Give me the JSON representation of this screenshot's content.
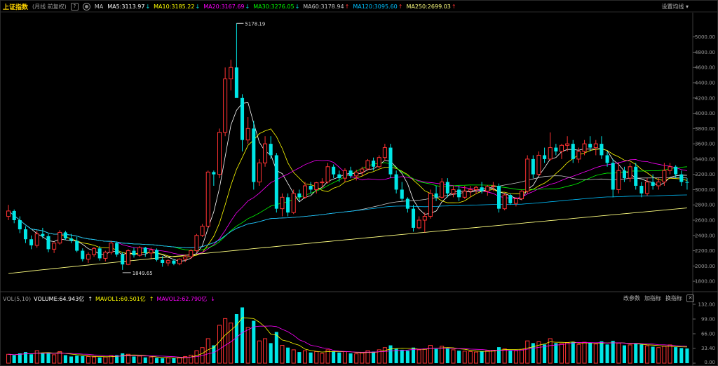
{
  "header": {
    "title": "上证指数",
    "subtitle": "(月线 前复权)",
    "help_icon": "question-icon",
    "settings_icon": "gear-icon",
    "ma_label": "MA",
    "ma": [
      {
        "label": "MA5:3113.97",
        "color": "#ffffff",
        "arrow": "↓"
      },
      {
        "label": "MA10:3185.22",
        "color": "#ffff00",
        "arrow": "↓"
      },
      {
        "label": "MA20:3167.69",
        "color": "#ff00ff",
        "arrow": "↓"
      },
      {
        "label": "MA30:3276.05",
        "color": "#00ff00",
        "arrow": "↓"
      },
      {
        "label": "MA60:3178.94",
        "color": "#c8c8c8",
        "arrow": "↑"
      },
      {
        "label": "MA120:3095.60",
        "color": "#00c0ff",
        "arrow": "↑"
      },
      {
        "label": "MA250:2699.03",
        "color": "#ffff80",
        "arrow": "↑"
      }
    ],
    "settings_label": "设置均线"
  },
  "price_axis": [
    "5000.00",
    "4800.00",
    "4600.00",
    "4400.00",
    "4200.00",
    "4000.00",
    "3800.00",
    "3600.00",
    "3400.00",
    "3200.00",
    "3000.00",
    "2800.00",
    "2600.00",
    "2400.00",
    "2200.00",
    "2000.00",
    "1800.00"
  ],
  "annotations": {
    "high": "5178.19",
    "low": "1849.65"
  },
  "volume": {
    "label": "VOL(5,10)",
    "vol": "VOLUME:64.943亿",
    "mavol1": "MAVOL1:60.501亿",
    "mavol2": "MAVOL2:62.790亿",
    "tools": [
      "改参数",
      "加指标",
      "换指标"
    ],
    "axis": [
      "132.00",
      "99.00",
      "66.00",
      "33.40",
      "0.00"
    ],
    "close_icon": "close-icon"
  },
  "colors": {
    "up": "#ff3232",
    "down": "#00e6e6",
    "bg": "#000000"
  },
  "chart_data": {
    "type": "candlestick",
    "title": "上证指数",
    "ylim": [
      1700,
      5300
    ],
    "candles": [
      [
        2650,
        2800,
        2600,
        2720,
        20
      ],
      [
        2720,
        2740,
        2560,
        2600,
        18
      ],
      [
        2600,
        2650,
        2430,
        2480,
        22
      ],
      [
        2480,
        2520,
        2300,
        2350,
        25
      ],
      [
        2350,
        2400,
        2220,
        2270,
        20
      ],
      [
        2270,
        2460,
        2240,
        2420,
        28
      ],
      [
        2420,
        2500,
        2360,
        2390,
        22
      ],
      [
        2390,
        2420,
        2180,
        2220,
        24
      ],
      [
        2220,
        2310,
        2170,
        2300,
        19
      ],
      [
        2300,
        2470,
        2280,
        2440,
        26
      ],
      [
        2440,
        2460,
        2340,
        2360,
        18
      ],
      [
        2360,
        2420,
        2300,
        2330,
        15
      ],
      [
        2330,
        2380,
        2180,
        2200,
        17
      ],
      [
        2200,
        2230,
        2060,
        2090,
        16
      ],
      [
        2090,
        2180,
        2040,
        2150,
        15
      ],
      [
        2150,
        2250,
        2120,
        2230,
        14
      ],
      [
        2230,
        2260,
        2070,
        2100,
        13
      ],
      [
        2100,
        2200,
        2060,
        2180,
        14
      ],
      [
        2180,
        2330,
        2150,
        2300,
        17
      ],
      [
        2300,
        2320,
        2120,
        2150,
        18
      ],
      [
        2150,
        2180,
        1949,
        2020,
        22
      ],
      [
        2020,
        2220,
        2010,
        2200,
        20
      ],
      [
        2200,
        2240,
        2110,
        2140,
        15
      ],
      [
        2140,
        2260,
        2120,
        2240,
        16
      ],
      [
        2240,
        2250,
        2120,
        2170,
        13
      ],
      [
        2170,
        2240,
        2100,
        2210,
        14
      ],
      [
        2210,
        2230,
        2060,
        2080,
        12
      ],
      [
        2080,
        2130,
        1990,
        2040,
        11
      ],
      [
        2040,
        2090,
        2000,
        2070,
        12
      ],
      [
        2070,
        2090,
        2010,
        2030,
        11
      ],
      [
        2030,
        2100,
        2010,
        2090,
        13
      ],
      [
        2090,
        2150,
        2050,
        2120,
        15
      ],
      [
        2120,
        2220,
        2090,
        2200,
        18
      ],
      [
        2200,
        2420,
        2180,
        2400,
        28
      ],
      [
        2400,
        2550,
        2380,
        2520,
        35
      ],
      [
        2520,
        3250,
        2500,
        3230,
        55
      ],
      [
        3230,
        3250,
        3050,
        3200,
        40
      ],
      [
        3200,
        3800,
        3150,
        3750,
        85
      ],
      [
        3750,
        4600,
        3700,
        4450,
        100
      ],
      [
        4450,
        4700,
        4300,
        4600,
        90
      ],
      [
        4600,
        5178,
        4400,
        4200,
        110
      ],
      [
        4200,
        4250,
        3500,
        3650,
        125
      ],
      [
        3650,
        3950,
        3600,
        3800,
        80
      ],
      [
        3800,
        3900,
        3000,
        3100,
        95
      ],
      [
        3100,
        3400,
        3050,
        3350,
        50
      ],
      [
        3350,
        3700,
        3300,
        3600,
        55
      ],
      [
        3600,
        3700,
        3400,
        3450,
        45
      ],
      [
        3450,
        3480,
        2700,
        2750,
        70
      ],
      [
        2750,
        2950,
        2650,
        2900,
        40
      ],
      [
        2900,
        2950,
        2650,
        2700,
        35
      ],
      [
        2700,
        3000,
        2680,
        2950,
        30
      ],
      [
        2950,
        3000,
        2850,
        2900,
        25
      ],
      [
        2900,
        3100,
        2880,
        3050,
        28
      ],
      [
        3050,
        3100,
        2950,
        3000,
        24
      ],
      [
        3000,
        3100,
        2950,
        3090,
        26
      ],
      [
        3090,
        3150,
        3020,
        3100,
        22
      ],
      [
        3100,
        3350,
        3080,
        3300,
        30
      ],
      [
        3300,
        3330,
        3150,
        3200,
        27
      ],
      [
        3200,
        3250,
        3100,
        3150,
        24
      ],
      [
        3150,
        3280,
        3100,
        3250,
        26
      ],
      [
        3250,
        3300,
        3150,
        3180,
        22
      ],
      [
        3180,
        3260,
        3120,
        3230,
        21
      ],
      [
        3230,
        3300,
        3180,
        3270,
        23
      ],
      [
        3270,
        3400,
        3250,
        3380,
        28
      ],
      [
        3380,
        3420,
        3250,
        3300,
        26
      ],
      [
        3300,
        3450,
        3280,
        3420,
        30
      ],
      [
        3420,
        3600,
        3380,
        3550,
        35
      ],
      [
        3550,
        3600,
        3150,
        3200,
        40
      ],
      [
        3200,
        3250,
        2950,
        3000,
        33
      ],
      [
        3000,
        3100,
        2850,
        2880,
        30
      ],
      [
        2880,
        2900,
        2700,
        2750,
        28
      ],
      [
        2750,
        2800,
        2450,
        2500,
        35
      ],
      [
        2500,
        2650,
        2480,
        2600,
        30
      ],
      [
        2600,
        2700,
        2440,
        2650,
        32
      ],
      [
        2650,
        3000,
        2620,
        2950,
        40
      ],
      [
        2950,
        3050,
        2850,
        2900,
        32
      ],
      [
        2900,
        3150,
        2880,
        3100,
        38
      ],
      [
        3100,
        3150,
        2900,
        2950,
        33
      ],
      [
        2950,
        3050,
        2900,
        3000,
        30
      ],
      [
        3000,
        3050,
        2850,
        2900,
        28
      ],
      [
        2900,
        3050,
        2880,
        2980,
        27
      ],
      [
        2980,
        3050,
        2900,
        3000,
        26
      ],
      [
        3000,
        3050,
        2940,
        3030,
        25
      ],
      [
        3030,
        3100,
        2950,
        2980,
        27
      ],
      [
        2980,
        3060,
        2920,
        3040,
        28
      ],
      [
        3040,
        3100,
        2980,
        3050,
        29
      ],
      [
        3050,
        3080,
        2700,
        2750,
        36
      ],
      [
        2750,
        2950,
        2730,
        2930,
        32
      ],
      [
        2930,
        2950,
        2800,
        2820,
        29
      ],
      [
        2820,
        2900,
        2780,
        2880,
        28
      ],
      [
        2880,
        3000,
        2860,
        2980,
        31
      ],
      [
        2980,
        3450,
        2950,
        3400,
        50
      ],
      [
        3400,
        3450,
        3150,
        3200,
        45
      ],
      [
        3200,
        3500,
        3180,
        3450,
        48
      ],
      [
        3450,
        3550,
        3350,
        3400,
        42
      ],
      [
        3400,
        3750,
        3380,
        3550,
        55
      ],
      [
        3550,
        3600,
        3450,
        3500,
        45
      ],
      [
        3500,
        3600,
        3400,
        3580,
        44
      ],
      [
        3580,
        3700,
        3500,
        3600,
        46
      ],
      [
        3600,
        3650,
        3350,
        3400,
        48
      ],
      [
        3400,
        3550,
        3350,
        3500,
        42
      ],
      [
        3500,
        3650,
        3450,
        3600,
        47
      ],
      [
        3600,
        3700,
        3500,
        3550,
        45
      ],
      [
        3550,
        3650,
        3450,
        3600,
        43
      ],
      [
        3600,
        3700,
        3400,
        3450,
        49
      ],
      [
        3450,
        3500,
        3300,
        3350,
        42
      ],
      [
        3350,
        3400,
        2900,
        3000,
        50
      ],
      [
        3000,
        3350,
        2950,
        3250,
        45
      ],
      [
        3250,
        3300,
        3100,
        3150,
        40
      ],
      [
        3150,
        3350,
        3100,
        3300,
        41
      ],
      [
        3300,
        3350,
        3000,
        3050,
        44
      ],
      [
        3050,
        3100,
        2900,
        2950,
        42
      ],
      [
        2950,
        3150,
        2920,
        3100,
        39
      ],
      [
        3100,
        3200,
        3000,
        3050,
        37
      ],
      [
        3050,
        3150,
        3000,
        3100,
        35
      ],
      [
        3100,
        3350,
        3050,
        3250,
        38
      ],
      [
        3250,
        3350,
        3200,
        3300,
        41
      ],
      [
        3300,
        3320,
        3150,
        3200,
        36
      ],
      [
        3200,
        3250,
        3050,
        3100,
        34
      ],
      [
        3100,
        3150,
        3000,
        3090,
        33
      ]
    ],
    "ma_lines": [
      "MA5",
      "MA10",
      "MA20",
      "MA30",
      "MA60",
      "MA120",
      "MA250"
    ]
  }
}
